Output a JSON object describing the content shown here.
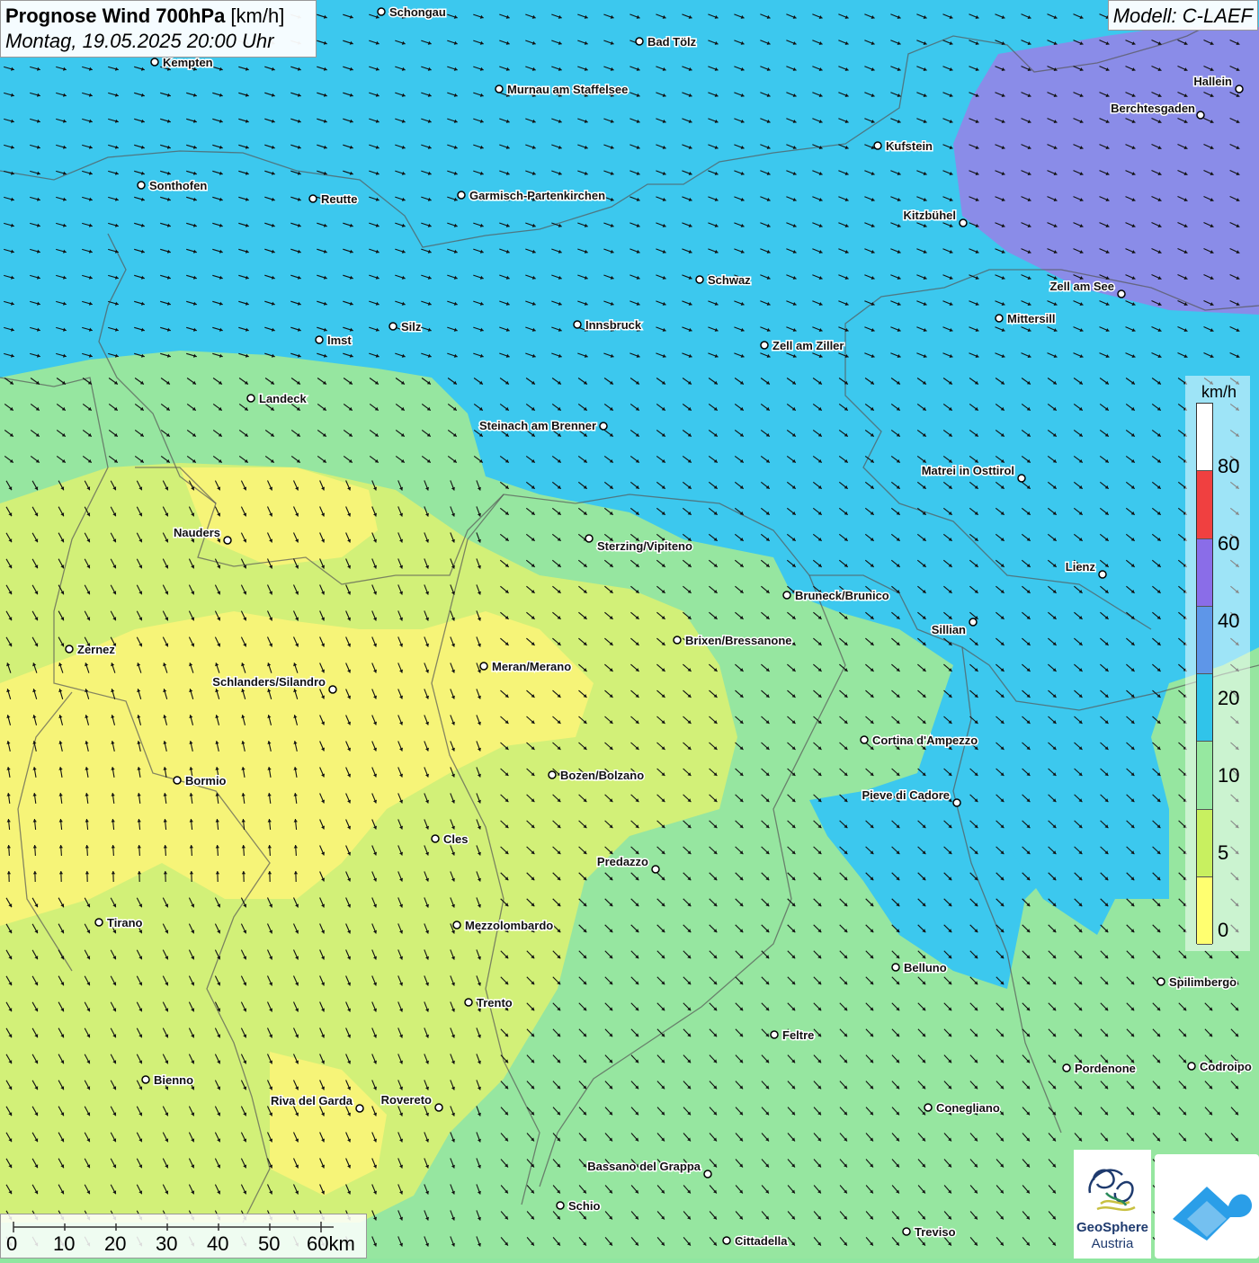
{
  "title": {
    "bold": "Prognose Wind 700hPa",
    "unit": " [km/h]",
    "date": "Montag, 19.05.2025 20:00 Uhr"
  },
  "model": "Modell: C-LAEF",
  "legend": {
    "unit": "km/h",
    "labels": [
      "80",
      "60",
      "40",
      "20",
      "10",
      "5",
      "0"
    ],
    "colors": [
      "#ffffff",
      "#f04040",
      "#8a6de8",
      "#5e96e8",
      "#30c4ea",
      "#96e8a0",
      "#c8f060",
      "#ffff70"
    ]
  },
  "colors": {
    "band_20_40": "#3cc8ee",
    "band_40_60": "#8a8ce8",
    "band_10_20": "#96e6a0",
    "band_5_10": "#d2f078",
    "band_0_5": "#f6f478"
  },
  "scalebar": {
    "labels": [
      "0",
      "10",
      "20",
      "30",
      "40",
      "50",
      "60km"
    ]
  },
  "logos": {
    "geosphere_line1": "GeoSphere",
    "geosphere_line2": "Austria"
  },
  "cities": [
    {
      "name": "Schongau"
    },
    {
      "name": "Bad Tölz"
    },
    {
      "name": "Kempten"
    },
    {
      "name": "Murnau am Staffelsee"
    },
    {
      "name": "Hallein"
    },
    {
      "name": "Berchtesgaden"
    },
    {
      "name": "Kufstein"
    },
    {
      "name": "Sonthofen"
    },
    {
      "name": "Reutte"
    },
    {
      "name": "Garmisch-Partenkirchen"
    },
    {
      "name": "Kitzbühel"
    },
    {
      "name": "Schwaz"
    },
    {
      "name": "Zell am See"
    },
    {
      "name": "Mittersill"
    },
    {
      "name": "Innsbruck"
    },
    {
      "name": "Silz"
    },
    {
      "name": "Imst"
    },
    {
      "name": "Zell am Ziller"
    },
    {
      "name": "Landeck"
    },
    {
      "name": "Steinach am Brenner"
    },
    {
      "name": "Matrei in Osttirol"
    },
    {
      "name": "Nauders"
    },
    {
      "name": "Sterzing/Vipiteno"
    },
    {
      "name": "Lienz"
    },
    {
      "name": "Bruneck/Brunico"
    },
    {
      "name": "Sillian"
    },
    {
      "name": "Brixen/Bressanone"
    },
    {
      "name": "Zernez"
    },
    {
      "name": "Meran/Merano"
    },
    {
      "name": "Schlanders/Silandro"
    },
    {
      "name": "Cortina d'Ampezzo"
    },
    {
      "name": "Bozen/Bolzano"
    },
    {
      "name": "Bormio"
    },
    {
      "name": "Pieve di Cadore"
    },
    {
      "name": "Cles"
    },
    {
      "name": "Predazzo"
    },
    {
      "name": "Tirano"
    },
    {
      "name": "Mezzolombardo"
    },
    {
      "name": "Belluno"
    },
    {
      "name": "Spilimbergo"
    },
    {
      "name": "Trento"
    },
    {
      "name": "Feltre"
    },
    {
      "name": "Bienno"
    },
    {
      "name": "Pordenone"
    },
    {
      "name": "Codroipo"
    },
    {
      "name": "Riva del Garda"
    },
    {
      "name": "Rovereto"
    },
    {
      "name": "Conegliano"
    },
    {
      "name": "Bassano del Grappa"
    },
    {
      "name": "Schio"
    },
    {
      "name": "Treviso"
    },
    {
      "name": "Cittadella"
    }
  ]
}
